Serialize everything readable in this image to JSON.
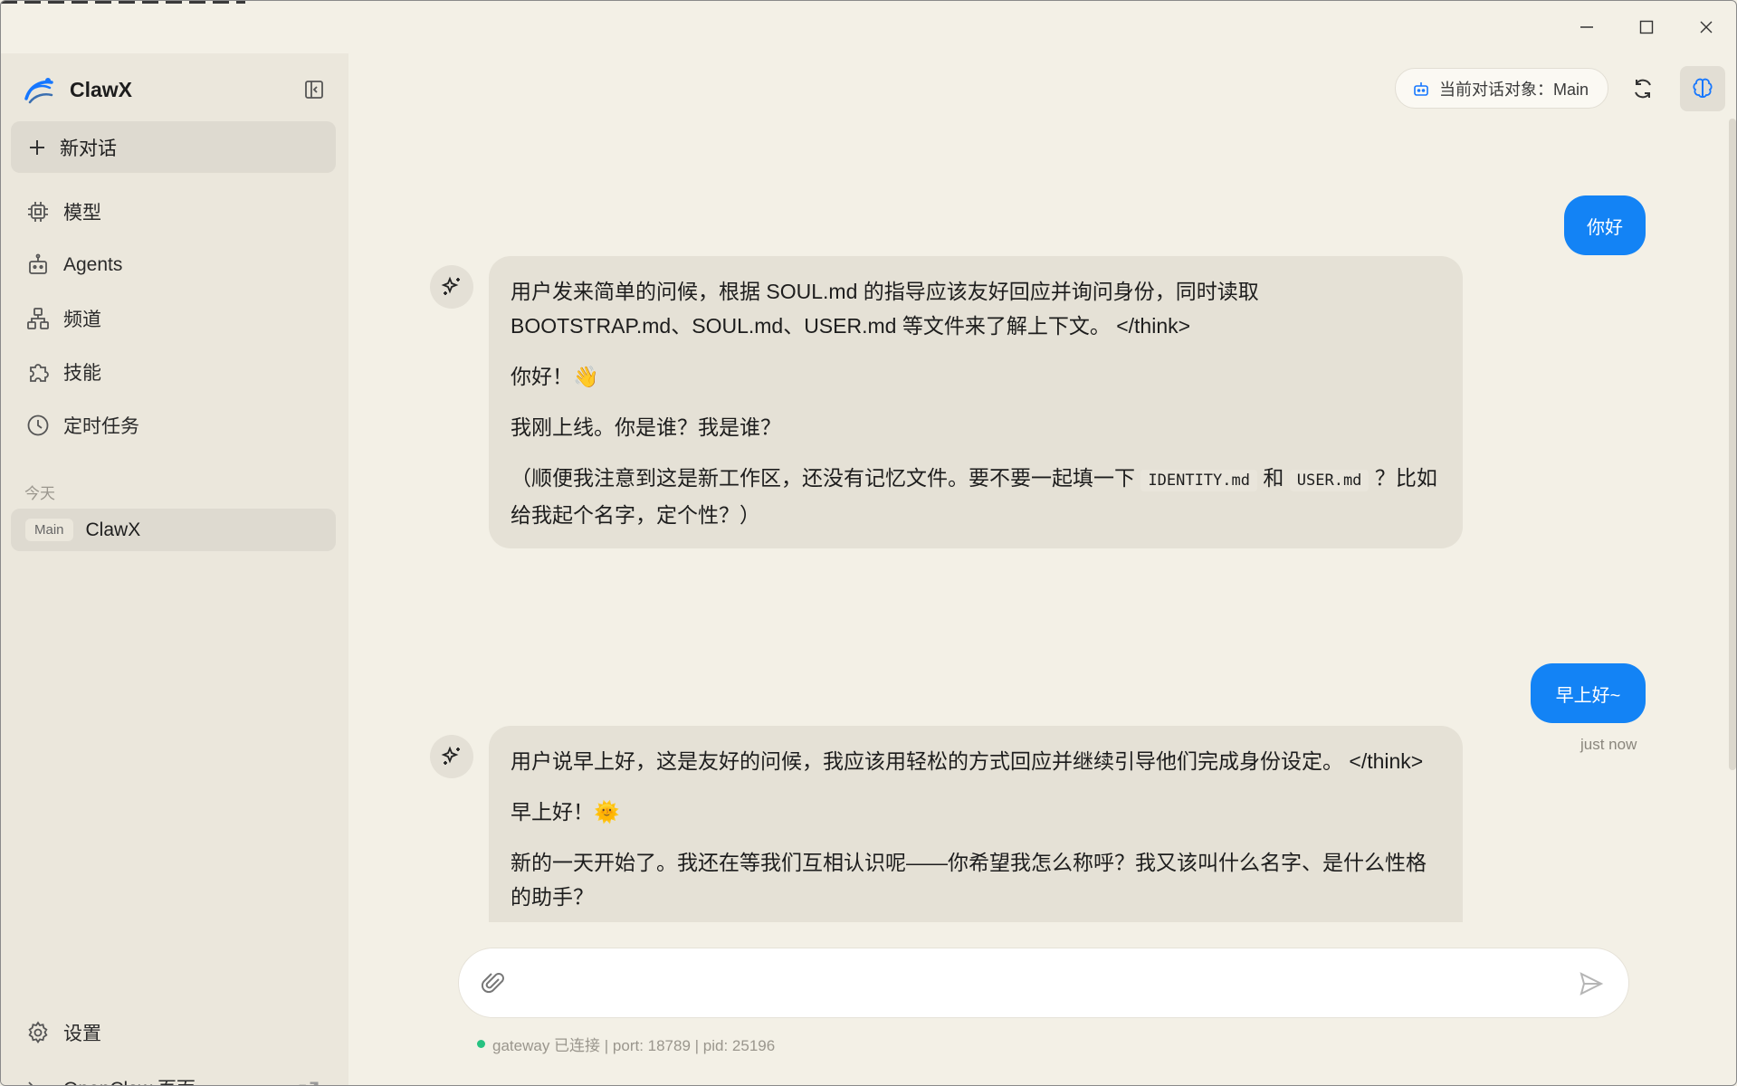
{
  "app": {
    "name": "ClawX"
  },
  "sidebar": {
    "new_chat": "新对话",
    "nav": [
      {
        "label": "模型",
        "icon": "cpu-icon"
      },
      {
        "label": "Agents",
        "icon": "bot-icon"
      },
      {
        "label": "频道",
        "icon": "network-icon"
      },
      {
        "label": "技能",
        "icon": "puzzle-icon"
      },
      {
        "label": "定时任务",
        "icon": "clock-icon"
      }
    ],
    "section_today": "今天",
    "session": {
      "badge": "Main",
      "name": "ClawX"
    },
    "settings": "设置",
    "openclaw": "OpenClaw 页面"
  },
  "header": {
    "target_label": "当前对话对象：Main"
  },
  "messages": {
    "user1": "你好",
    "bot1": {
      "p1": "用户发来简单的问候，根据 SOUL.md 的指导应该友好回应并询问身份，同时读取 BOOTSTRAP.md、SOUL.md、USER.md 等文件来了解上下文。 </think>",
      "p2": "你好！👋",
      "p3": "我刚上线。你是谁？我是谁？",
      "p4_a": "（顺便我注意到这是新工作区，还没有记忆文件。要不要一起填一下",
      "p4_code1": "IDENTITY.md",
      "p4_b": "和",
      "p4_code2": "USER.md",
      "p4_c": "？比如给我起个名字，定个性？）"
    },
    "user2": "早上好~",
    "user2_time": "just now",
    "bot2": {
      "p1": "用户说早上好，这是友好的问候，我应该用轻松的方式回应并继续引导他们完成身份设定。 </think>",
      "p2": "早上好！🌞",
      "p3": "新的一天开始了。我还在等我们互相认识呢——你希望我怎么称呼？我又该叫什么名字、是什么性格的助手？"
    }
  },
  "composer": {
    "placeholder": ""
  },
  "status": {
    "text": "gateway 已连接 | port: 18789 | pid: 25196"
  }
}
